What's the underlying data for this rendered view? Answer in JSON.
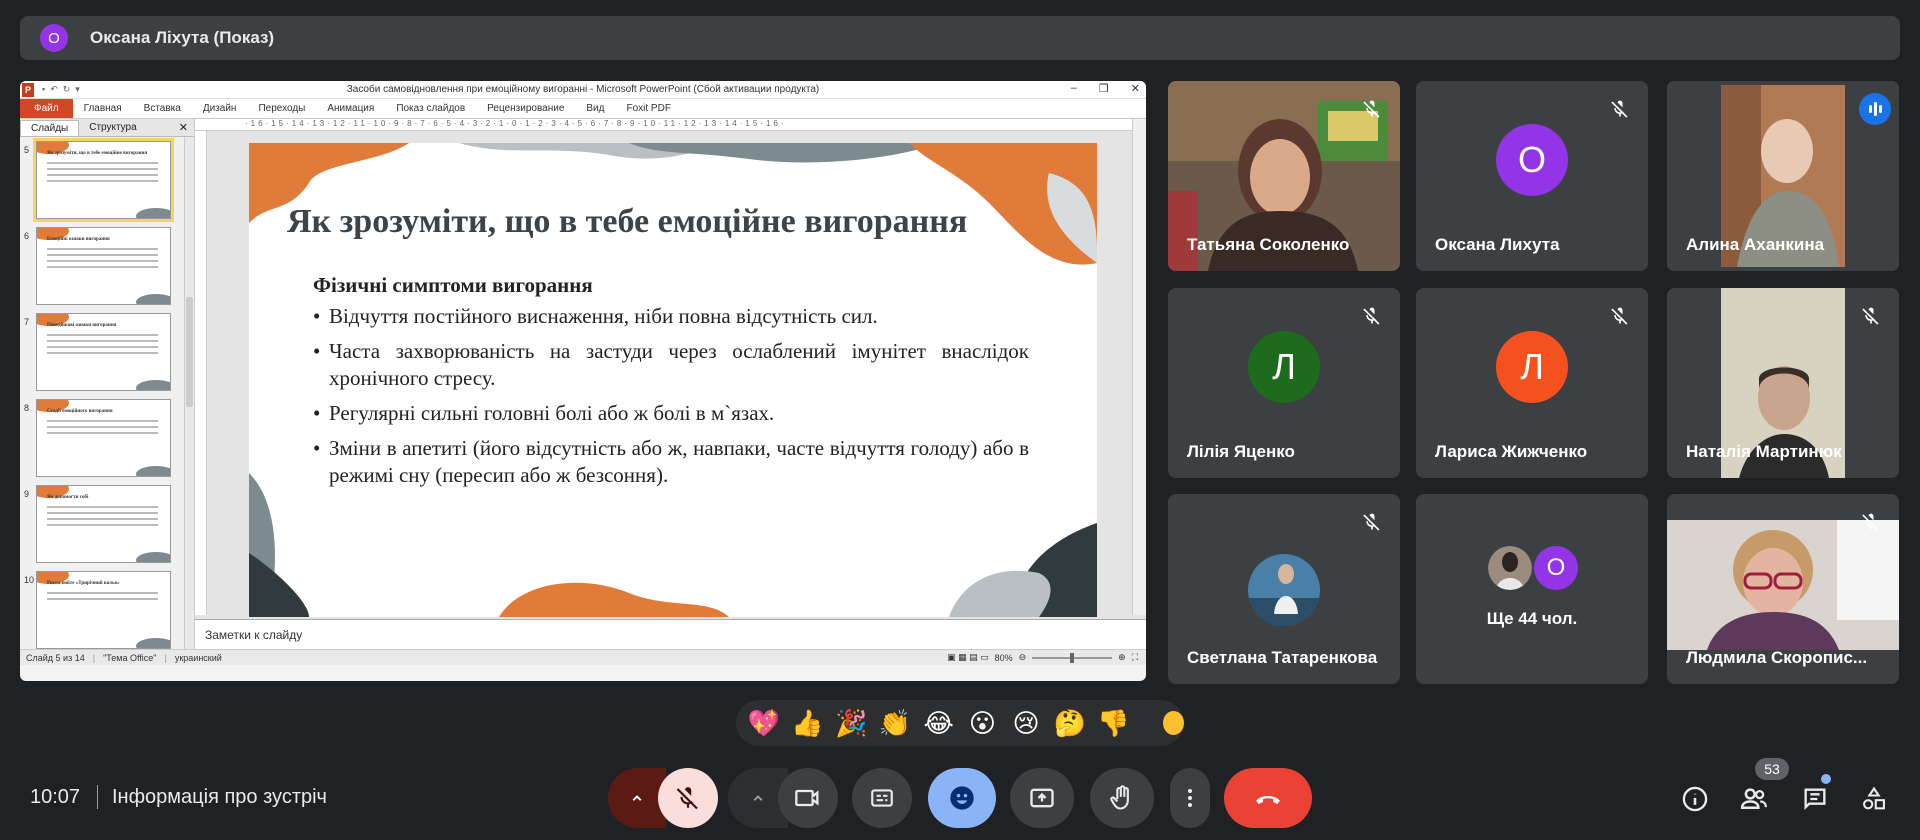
{
  "presenter": {
    "initial": "О",
    "label": "Оксана Ліхута (Показ)"
  },
  "ppt": {
    "window_title": "Засоби самовідновлення при емоційному вигоранні  -  Microsoft PowerPoint (Сбой активации продукта)",
    "tabs": [
      "Файл",
      "Главная",
      "Вставка",
      "Дизайн",
      "Переходы",
      "Анимация",
      "Показ слайдов",
      "Рецензирование",
      "Вид",
      "Foxit PDF"
    ],
    "pane_tabs": [
      "Слайды",
      "Структура"
    ],
    "thumbnails": [
      {
        "num": "5",
        "title": "Як зрозуміти, що в тебе емоційне вигорання"
      },
      {
        "num": "6",
        "title": "Емоційні ознаки вигорання"
      },
      {
        "num": "7",
        "title": "Поведінкові ознаки вигорання"
      },
      {
        "num": "8",
        "title": "Стадії емоційного вигорання"
      },
      {
        "num": "9",
        "title": "Як допомогти собі"
      },
      {
        "num": "10",
        "title": "Розмалюйте «Трирічний кольо»"
      }
    ],
    "ruler": "·16·15·14·13·12·11·10·9·8·7·6·5·4·3·2·1·0·1·2·3·4·5·6·7·8·9·10·11·12·13·14·15·16·",
    "slide": {
      "title": "Як зрозуміти, що в тебе емоційне вигорання",
      "subtitle": "Фізичні симптоми вигорання",
      "bullets": [
        "Відчуття постійного виснаження, ніби повна відсутність сил.",
        "Часта захворюваність на застуди через ослаблений імунітет внаслідок хронічного стресу.",
        "Регулярні сильні головні болі або ж болі в м`язах.",
        "Зміни в апетиті (його відсутність або ж, навпаки, часте відчуття голоду) або в режимі сну (пересип або ж безсоння)."
      ]
    },
    "notes_placeholder": "Заметки к слайду",
    "status": {
      "slide": "Слайд 5 из 14",
      "theme": "\"Тема Office\"",
      "lang": "украинский",
      "zoom": "80%"
    }
  },
  "tiles": [
    {
      "name": "Татьяна Соколенко",
      "type": "video"
    },
    {
      "name": "Оксана Лихута",
      "type": "avatar",
      "initial": "О",
      "color": "#9334e6"
    },
    {
      "name": "Алина Аханкина",
      "type": "video"
    },
    {
      "name": "Лілія Яценко",
      "type": "avatar",
      "initial": "Л",
      "color": "#1e6b1e"
    },
    {
      "name": "Лариса Жижченко",
      "type": "avatar",
      "initial": "Л",
      "color": "#f4511e"
    },
    {
      "name": "Наталія Мартинюк",
      "type": "video"
    },
    {
      "name": "Светлана Татаренкова",
      "type": "photo"
    },
    {
      "name": "Ще 44 чол.",
      "type": "more",
      "initial": "О"
    },
    {
      "name": "Людмила Скоропис...",
      "type": "video"
    }
  ],
  "reactions": [
    "💖",
    "👍",
    "🎉",
    "👏",
    "😂",
    "😮",
    "😢",
    "🤔",
    "👎"
  ],
  "bottom": {
    "time": "10:07",
    "meeting_info": "Інформація про зустріч",
    "people_count": "53"
  },
  "colors": {
    "end_call": "#ea4335",
    "mic_off_bg": "#f9dedc",
    "active_blue": "#8ab4f8",
    "ppt_accent": "#d24726"
  }
}
